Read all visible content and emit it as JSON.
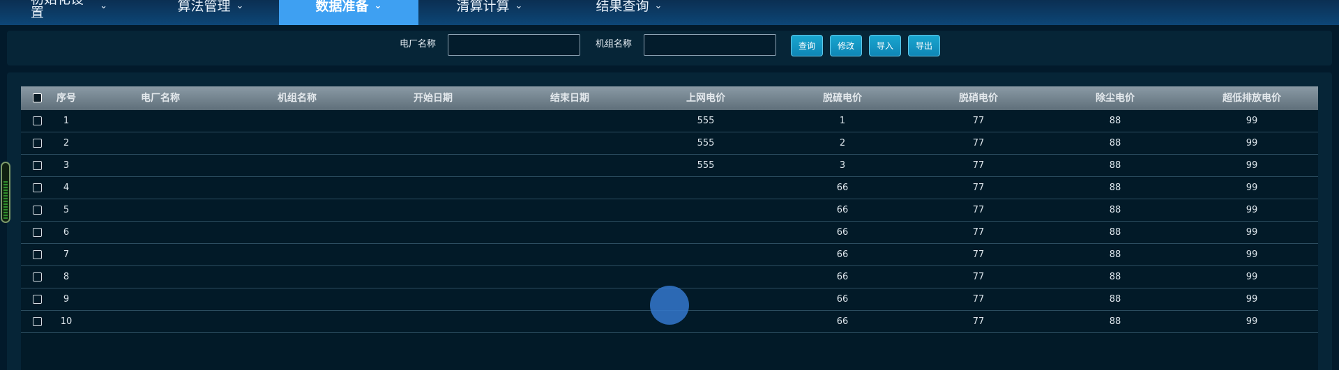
{
  "nav": {
    "items": [
      {
        "label": "初始化设置"
      },
      {
        "label": "算法管理"
      },
      {
        "label": "数据准备"
      },
      {
        "label": "清算计算"
      },
      {
        "label": "结果查询"
      }
    ],
    "chevron": "⌄"
  },
  "search": {
    "plant_label": "电厂名称",
    "plant_value": "",
    "unit_label": "机组名称",
    "unit_value": "",
    "buttons": [
      "查询",
      "修改",
      "导入",
      "导出"
    ]
  },
  "table": {
    "columns": [
      "序号",
      "电厂名称",
      "机组名称",
      "开始日期",
      "结束日期",
      "上网电价",
      "脱硫电价",
      "脱硝电价",
      "除尘电价",
      "超低排放电价"
    ],
    "rows": [
      [
        "1",
        "",
        "",
        "",
        "",
        "555",
        "1",
        "77",
        "88",
        "99"
      ],
      [
        "2",
        "",
        "",
        "",
        "",
        "555",
        "2",
        "77",
        "88",
        "99"
      ],
      [
        "3",
        "",
        "",
        "",
        "",
        "555",
        "3",
        "77",
        "88",
        "99"
      ],
      [
        "4",
        "",
        "",
        "",
        "",
        "",
        "66",
        "77",
        "88",
        "99"
      ],
      [
        "5",
        "",
        "",
        "",
        "",
        "",
        "66",
        "77",
        "88",
        "99"
      ],
      [
        "6",
        "",
        "",
        "",
        "",
        "",
        "66",
        "77",
        "88",
        "99"
      ],
      [
        "7",
        "",
        "",
        "",
        "",
        "",
        "66",
        "77",
        "88",
        "99"
      ],
      [
        "8",
        "",
        "",
        "",
        "",
        "",
        "66",
        "77",
        "88",
        "99"
      ],
      [
        "9",
        "",
        "",
        "",
        "",
        "",
        "66",
        "77",
        "88",
        "99"
      ],
      [
        "10",
        "",
        "",
        "",
        "",
        "",
        "66",
        "77",
        "88",
        "99"
      ]
    ]
  },
  "colors": {
    "nav_active": "#3ea0f2",
    "button": "#1196c3",
    "background": "#021a2b"
  }
}
